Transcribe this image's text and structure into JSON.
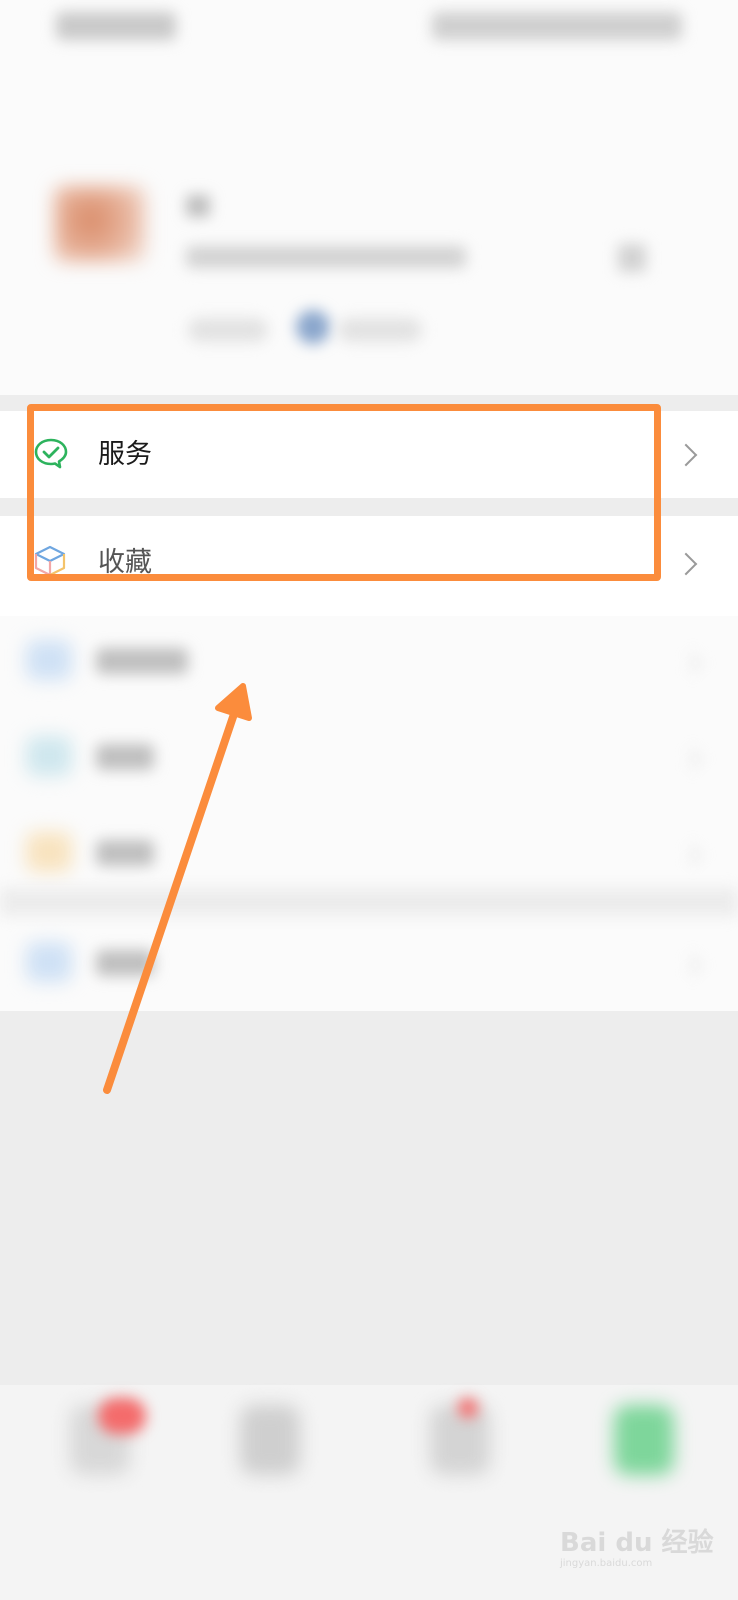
{
  "menu": {
    "service_label": "服务",
    "favorites_label": "收藏"
  },
  "colors": {
    "highlight": "#fb8c3c",
    "service_icon": "#2db35d",
    "background": "#ededed"
  },
  "watermark": {
    "text": "Bai du 经验",
    "sub": "jingyan.baidu.com"
  }
}
